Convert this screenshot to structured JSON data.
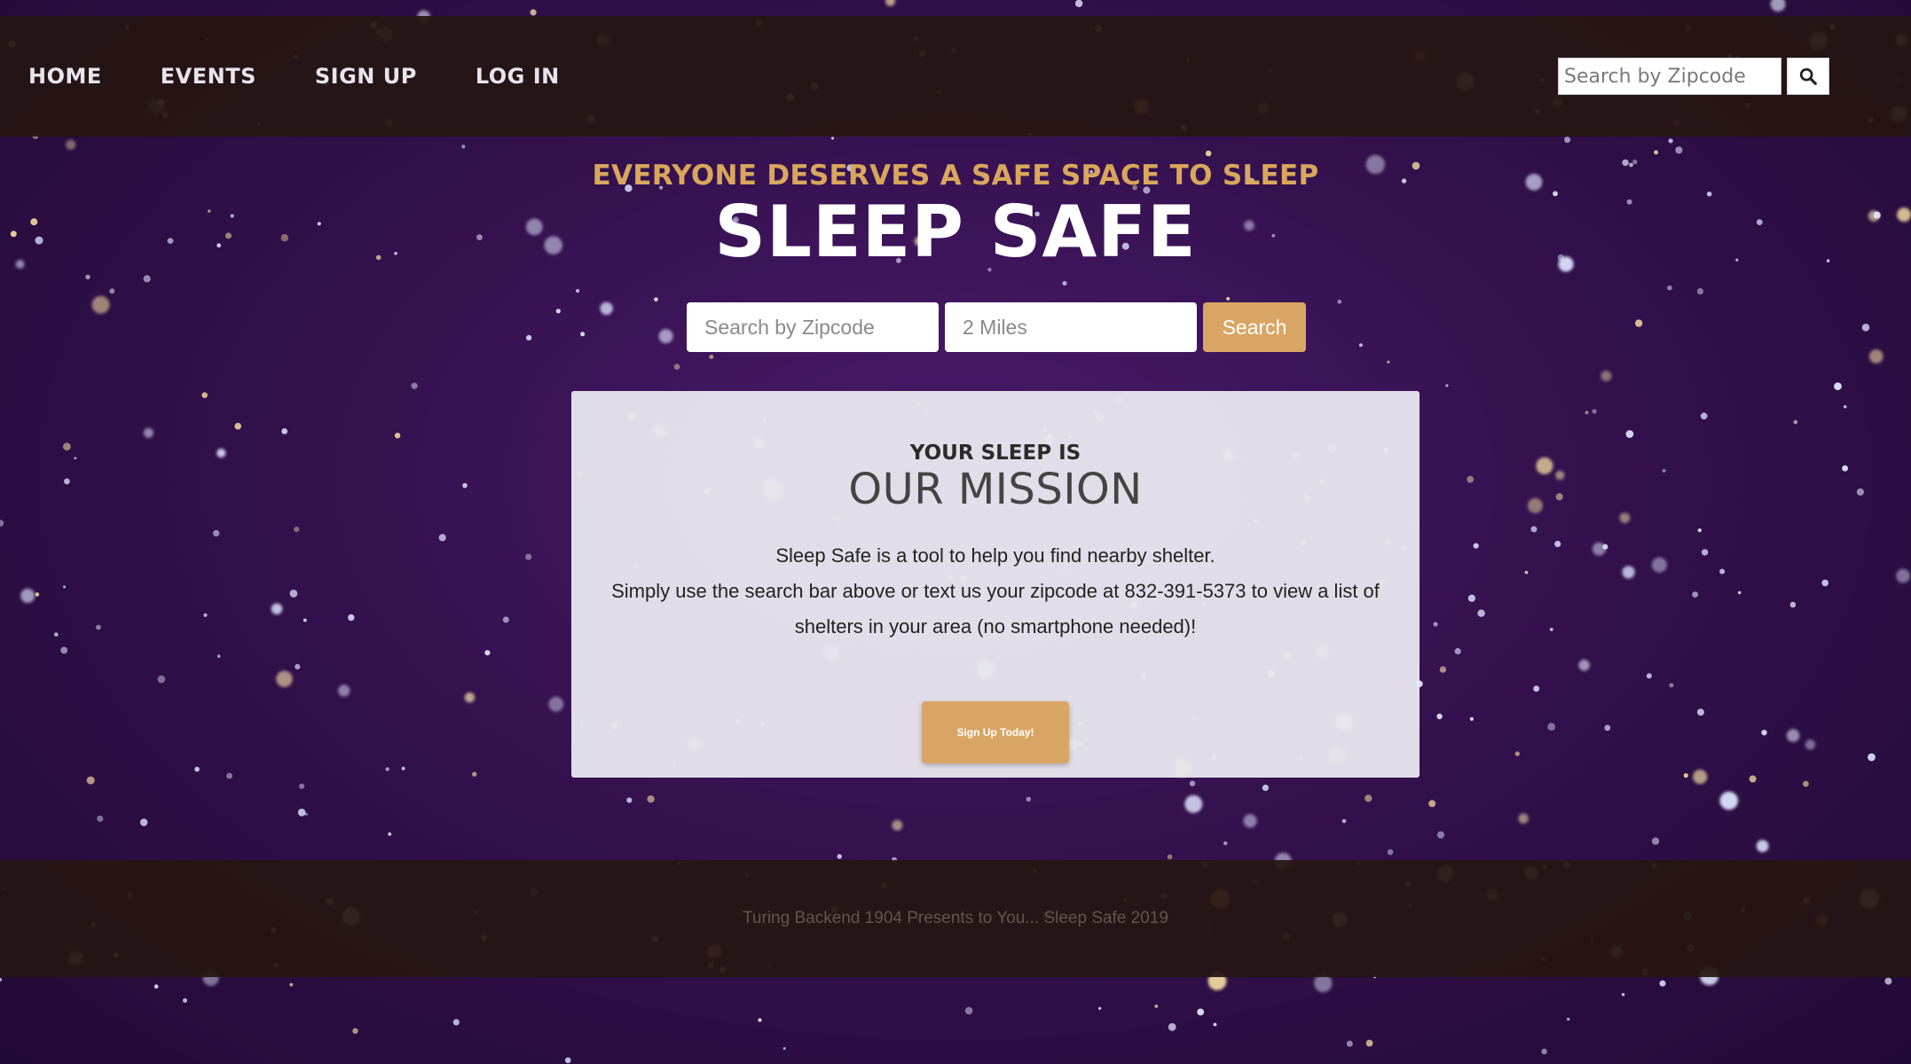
{
  "nav": {
    "links": [
      "HOME",
      "EVENTS",
      "SIGN UP",
      "LOG IN"
    ],
    "search_placeholder": "Search by Zipcode",
    "search_icon": "search-icon"
  },
  "hero": {
    "tagline": "EVERYONE DESERVES A SAFE SPACE TO SLEEP",
    "title": "SLEEP SAFE",
    "zip_placeholder": "Search by Zipcode",
    "miles_placeholder": "2 Miles",
    "search_label": "Search"
  },
  "mission": {
    "kicker": "YOUR SLEEP IS",
    "heading": "OUR MISSION",
    "line1": "Sleep Safe is a tool to help you find nearby shelter.",
    "line2": "Simply use the search bar above or text us your zipcode at 832-391-5373 to view a list of shelters in your area (no smartphone needed)!",
    "signup_label": "Sign Up Today!"
  },
  "footer": {
    "text": "Turing Backend 1904 Presents to You... Sleep Safe 2019"
  },
  "colors": {
    "accent": "#d9a564",
    "bar": "#261612",
    "background": "#35114f"
  }
}
